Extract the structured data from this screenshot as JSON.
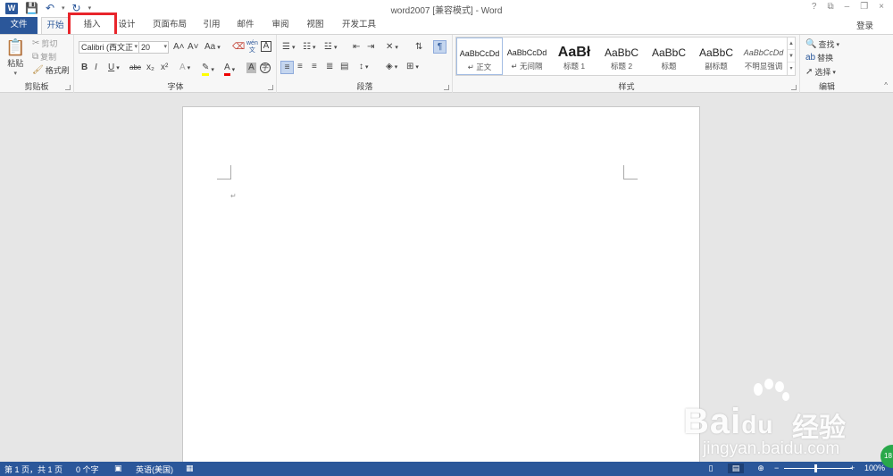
{
  "titlebar": {
    "logo": "W",
    "title": "word2007 [兼容模式] - Word",
    "controls": [
      "?",
      "⧉",
      "–",
      "❐",
      "×"
    ]
  },
  "qat": {
    "save": "💾",
    "undo": "↶",
    "redo": "↻",
    "more": "▾"
  },
  "tabs": {
    "file": "文件",
    "items": [
      "开始",
      "插入",
      "设计",
      "页面布局",
      "引用",
      "邮件",
      "审阅",
      "视图",
      "开发工具"
    ],
    "login": "登录"
  },
  "clipboard": {
    "paste": "粘贴",
    "cut": "剪切",
    "copy": "复制",
    "format_painter": "格式刷",
    "label": "剪贴板"
  },
  "font": {
    "name": "Calibri (西文正",
    "size": "20",
    "grow": "A˄",
    "shrink": "A˅",
    "case": "Aa",
    "clear": "A",
    "bold": "B",
    "italic": "I",
    "underline": "U",
    "strike": "abc",
    "sub": "x₂",
    "sup": "x²",
    "label": "字体"
  },
  "paragraph": {
    "label": "段落"
  },
  "styles": {
    "items": [
      {
        "sample": "AaBbCcDd",
        "name": "↵ 正文"
      },
      {
        "sample": "AaBbCcDd",
        "name": "↵ 无间隔"
      },
      {
        "sample": "AaBł",
        "name": "标题 1"
      },
      {
        "sample": "AaBbC",
        "name": "标题 2"
      },
      {
        "sample": "AaBbC",
        "name": "标题"
      },
      {
        "sample": "AaBbC",
        "name": "副标题"
      },
      {
        "sample": "AaBbCcDd",
        "name": "不明显强调"
      }
    ],
    "label": "样式"
  },
  "editing": {
    "find": "查找",
    "replace": "替换",
    "select": "选择",
    "label": "编辑"
  },
  "document": {
    "paragraph_mark": "↵"
  },
  "status": {
    "page": "第 1 页，共 1 页",
    "words": "0 个字",
    "language": "英语(美国)",
    "zoom": "100%",
    "zoom_minus": "−",
    "zoom_plus": "+"
  },
  "watermark": {
    "brand": "Bai",
    "brand2": "du",
    "cn": "经验",
    "url": "jingyan.baidu.com",
    "badge": "18"
  },
  "colors": {
    "accent": "#2b579a",
    "highlight": "#e8252b"
  }
}
